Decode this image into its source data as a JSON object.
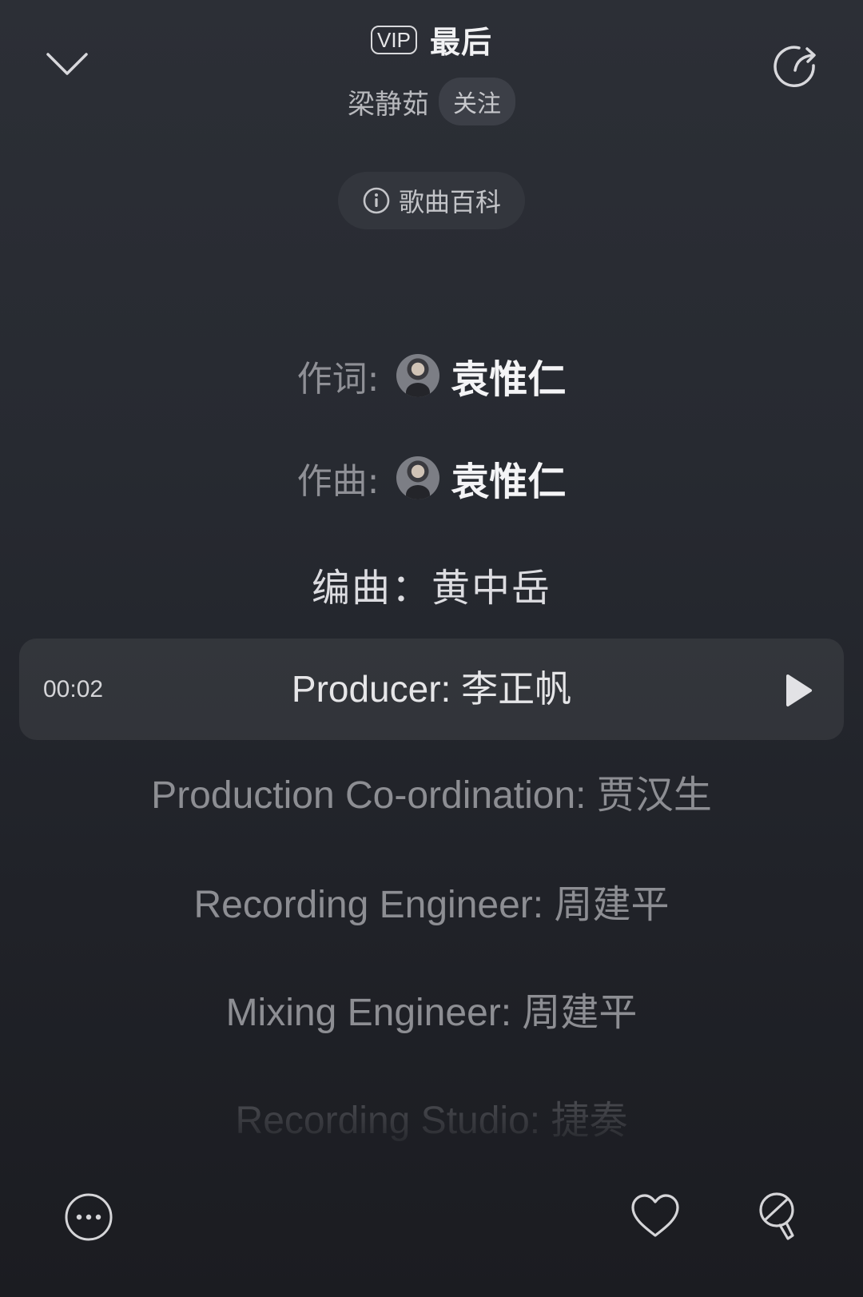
{
  "header": {
    "vip_badge": "VIP",
    "song_title": "最后",
    "artist": "梁静茹",
    "follow_label": "关注",
    "wiki_label": "歌曲百科"
  },
  "credits": {
    "lyricist_role": "作词:",
    "lyricist_name": "袁惟仁",
    "composer_role": "作曲:",
    "composer_name": "袁惟仁",
    "arranger_line": "编曲：黄中岳"
  },
  "current_line": {
    "time": "00:02",
    "text": "Producer: 李正帆"
  },
  "lyrics": [
    "Production Co-ordination: 贾汉生",
    "Recording Engineer: 周建平",
    "Mixing Engineer: 周建平",
    "Recording Studio: 捷奏"
  ],
  "icons": {
    "collapse": "chevron-down-icon",
    "share": "share-icon",
    "info": "info-icon",
    "play": "play-icon",
    "more": "more-icon",
    "like": "heart-icon",
    "karaoke": "microphone-icon"
  },
  "colors": {
    "background_top": "#2c2f36",
    "background_bottom": "#1b1c21",
    "highlight_row": "#36383f"
  }
}
